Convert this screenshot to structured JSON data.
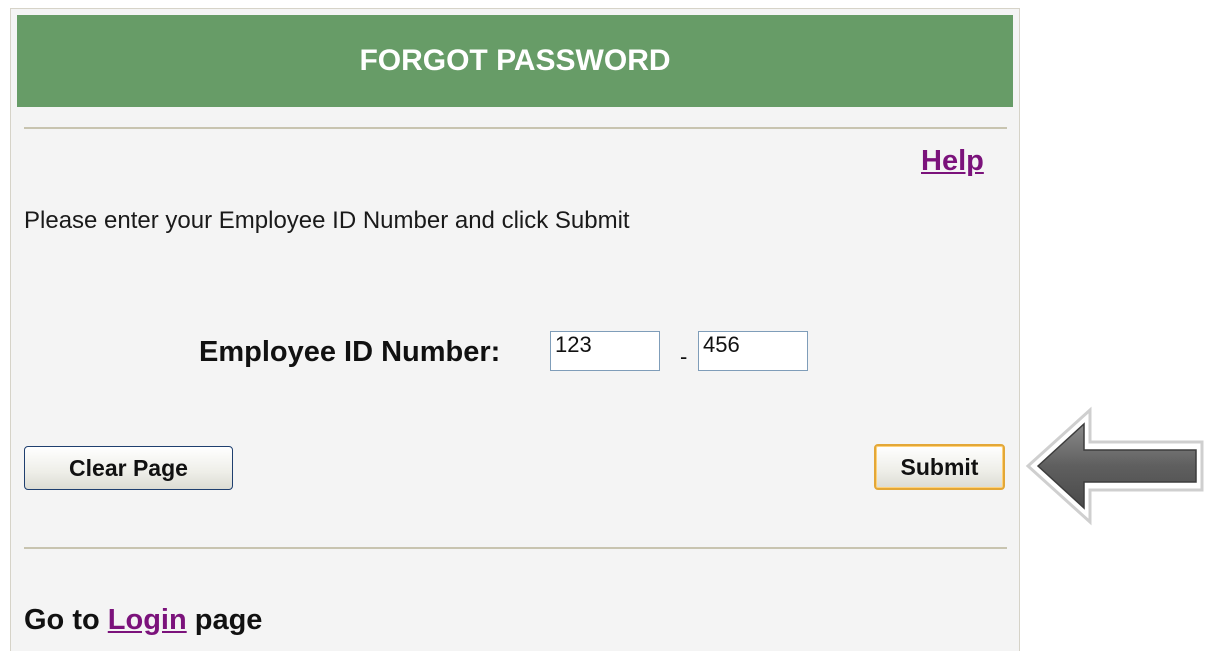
{
  "header": {
    "title": "FORGOT PASSWORD"
  },
  "help": {
    "label": "Help"
  },
  "instructions": "Please enter your Employee ID Number and click Submit",
  "employee_id": {
    "label": "Employee ID Number:",
    "part1_value": "123",
    "separator": "-",
    "part2_value": "456"
  },
  "buttons": {
    "clear_label": "Clear Page",
    "submit_label": "Submit"
  },
  "footer": {
    "prefix": "Go to ",
    "link_label": "Login",
    "suffix": " page"
  },
  "annotation": {
    "icon": "left-arrow-icon",
    "color": "#5f5f5f"
  },
  "colors": {
    "header_bg": "#679c67",
    "link": "#7b127b",
    "panel_bg": "#f4f4f4"
  }
}
